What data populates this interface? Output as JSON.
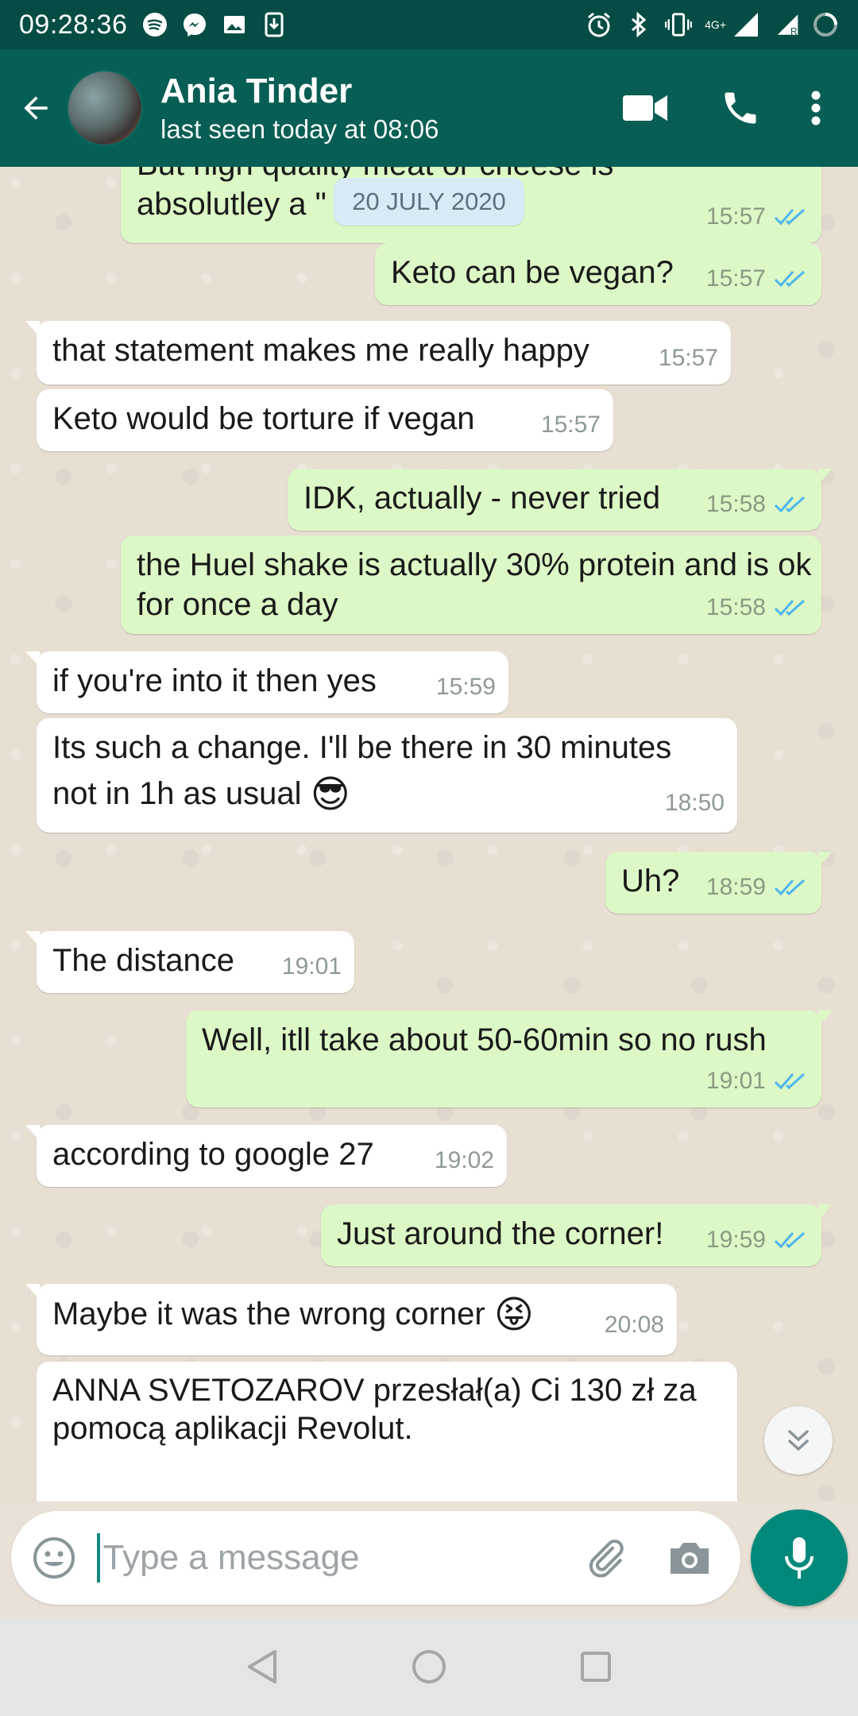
{
  "status_bar": {
    "time": "09:28:36",
    "network": "4G+"
  },
  "header": {
    "contact_name": "Ania Tinder",
    "last_seen": "last seen today at 08:06"
  },
  "date_pill": "20 JULY 2020",
  "messages": [
    {
      "dir": "out",
      "text": "But high quality meat or cheese is absolutley a \"            !\"",
      "time": "15:57",
      "status": "read"
    },
    {
      "dir": "out",
      "text": "Keto can be vegan?",
      "time": "15:57",
      "status": "read"
    },
    {
      "dir": "in",
      "text": "that statement makes me really happy",
      "time": "15:57"
    },
    {
      "dir": "in",
      "text": "Keto would be torture if vegan",
      "time": "15:57"
    },
    {
      "dir": "out",
      "text": "IDK, actually - never tried",
      "time": "15:58",
      "status": "read"
    },
    {
      "dir": "out",
      "text": "the Huel shake is actually 30% protein and is ok for once a day",
      "time": "15:58",
      "status": "read"
    },
    {
      "dir": "in",
      "text": "if you're into it then yes",
      "time": "15:59"
    },
    {
      "dir": "in",
      "text": "Its such a change. I'll be there in 30 minutes not in 1h as usual",
      "emoji": "😎",
      "time": "18:50"
    },
    {
      "dir": "out",
      "text": "Uh?",
      "time": "18:59",
      "status": "read"
    },
    {
      "dir": "in",
      "text": "The distance",
      "time": "19:01"
    },
    {
      "dir": "out",
      "text": "Well, itll take about 50-60min so no rush",
      "time": "19:01",
      "status": "read"
    },
    {
      "dir": "in",
      "text": "according to google 27",
      "time": "19:02"
    },
    {
      "dir": "out",
      "text": "Just around the corner!",
      "time": "19:59",
      "status": "read"
    },
    {
      "dir": "in",
      "text": "Maybe it was the wrong corner",
      "emoji": "😝",
      "time": "20:08"
    },
    {
      "dir": "in",
      "text": "ANNA SVETOZAROV przesłał(a) Ci 130 zł za pomocą aplikacji Revolut.",
      "time": ""
    }
  ],
  "input": {
    "placeholder": "Type a message"
  },
  "colors": {
    "header": "#075e54",
    "status_bar": "#054d44",
    "outgoing_bubble": "#dcf8c6",
    "incoming_bubble": "#ffffff",
    "read_ticks": "#4fb6ec",
    "mic_button": "#00897b"
  },
  "icons": {
    "back": "arrow-left-icon",
    "video": "video-camera-icon",
    "call": "phone-icon",
    "menu": "more-vert-icon",
    "emoji": "emoji-icon",
    "attach": "paperclip-icon",
    "camera": "camera-icon",
    "mic": "mic-icon",
    "scroll": "chevrons-down-icon"
  }
}
